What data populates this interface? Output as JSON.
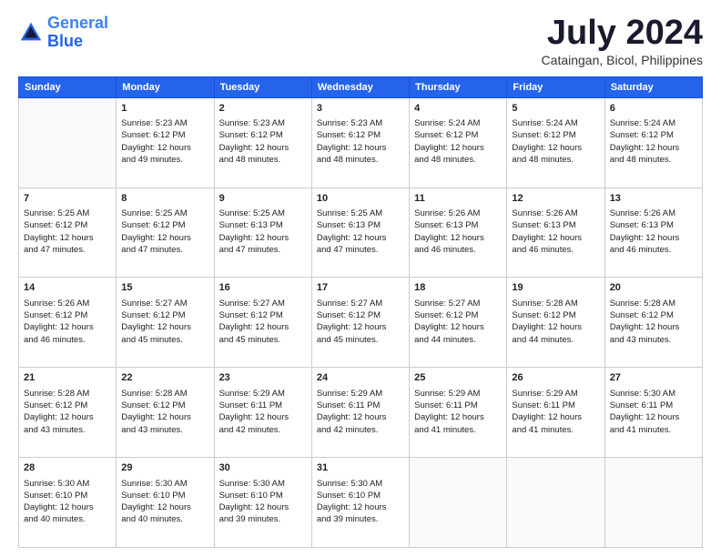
{
  "logo": {
    "line1": "General",
    "line2": "Blue"
  },
  "title": "July 2024",
  "subtitle": "Cataingan, Bicol, Philippines",
  "weekdays": [
    "Sunday",
    "Monday",
    "Tuesday",
    "Wednesday",
    "Thursday",
    "Friday",
    "Saturday"
  ],
  "weeks": [
    [
      {
        "day": "",
        "lines": []
      },
      {
        "day": "1",
        "lines": [
          "Sunrise: 5:23 AM",
          "Sunset: 6:12 PM",
          "Daylight: 12 hours",
          "and 49 minutes."
        ]
      },
      {
        "day": "2",
        "lines": [
          "Sunrise: 5:23 AM",
          "Sunset: 6:12 PM",
          "Daylight: 12 hours",
          "and 48 minutes."
        ]
      },
      {
        "day": "3",
        "lines": [
          "Sunrise: 5:23 AM",
          "Sunset: 6:12 PM",
          "Daylight: 12 hours",
          "and 48 minutes."
        ]
      },
      {
        "day": "4",
        "lines": [
          "Sunrise: 5:24 AM",
          "Sunset: 6:12 PM",
          "Daylight: 12 hours",
          "and 48 minutes."
        ]
      },
      {
        "day": "5",
        "lines": [
          "Sunrise: 5:24 AM",
          "Sunset: 6:12 PM",
          "Daylight: 12 hours",
          "and 48 minutes."
        ]
      },
      {
        "day": "6",
        "lines": [
          "Sunrise: 5:24 AM",
          "Sunset: 6:12 PM",
          "Daylight: 12 hours",
          "and 48 minutes."
        ]
      }
    ],
    [
      {
        "day": "7",
        "lines": [
          "Sunrise: 5:25 AM",
          "Sunset: 6:12 PM",
          "Daylight: 12 hours",
          "and 47 minutes."
        ]
      },
      {
        "day": "8",
        "lines": [
          "Sunrise: 5:25 AM",
          "Sunset: 6:12 PM",
          "Daylight: 12 hours",
          "and 47 minutes."
        ]
      },
      {
        "day": "9",
        "lines": [
          "Sunrise: 5:25 AM",
          "Sunset: 6:13 PM",
          "Daylight: 12 hours",
          "and 47 minutes."
        ]
      },
      {
        "day": "10",
        "lines": [
          "Sunrise: 5:25 AM",
          "Sunset: 6:13 PM",
          "Daylight: 12 hours",
          "and 47 minutes."
        ]
      },
      {
        "day": "11",
        "lines": [
          "Sunrise: 5:26 AM",
          "Sunset: 6:13 PM",
          "Daylight: 12 hours",
          "and 46 minutes."
        ]
      },
      {
        "day": "12",
        "lines": [
          "Sunrise: 5:26 AM",
          "Sunset: 6:13 PM",
          "Daylight: 12 hours",
          "and 46 minutes."
        ]
      },
      {
        "day": "13",
        "lines": [
          "Sunrise: 5:26 AM",
          "Sunset: 6:13 PM",
          "Daylight: 12 hours",
          "and 46 minutes."
        ]
      }
    ],
    [
      {
        "day": "14",
        "lines": [
          "Sunrise: 5:26 AM",
          "Sunset: 6:12 PM",
          "Daylight: 12 hours",
          "and 46 minutes."
        ]
      },
      {
        "day": "15",
        "lines": [
          "Sunrise: 5:27 AM",
          "Sunset: 6:12 PM",
          "Daylight: 12 hours",
          "and 45 minutes."
        ]
      },
      {
        "day": "16",
        "lines": [
          "Sunrise: 5:27 AM",
          "Sunset: 6:12 PM",
          "Daylight: 12 hours",
          "and 45 minutes."
        ]
      },
      {
        "day": "17",
        "lines": [
          "Sunrise: 5:27 AM",
          "Sunset: 6:12 PM",
          "Daylight: 12 hours",
          "and 45 minutes."
        ]
      },
      {
        "day": "18",
        "lines": [
          "Sunrise: 5:27 AM",
          "Sunset: 6:12 PM",
          "Daylight: 12 hours",
          "and 44 minutes."
        ]
      },
      {
        "day": "19",
        "lines": [
          "Sunrise: 5:28 AM",
          "Sunset: 6:12 PM",
          "Daylight: 12 hours",
          "and 44 minutes."
        ]
      },
      {
        "day": "20",
        "lines": [
          "Sunrise: 5:28 AM",
          "Sunset: 6:12 PM",
          "Daylight: 12 hours",
          "and 43 minutes."
        ]
      }
    ],
    [
      {
        "day": "21",
        "lines": [
          "Sunrise: 5:28 AM",
          "Sunset: 6:12 PM",
          "Daylight: 12 hours",
          "and 43 minutes."
        ]
      },
      {
        "day": "22",
        "lines": [
          "Sunrise: 5:28 AM",
          "Sunset: 6:12 PM",
          "Daylight: 12 hours",
          "and 43 minutes."
        ]
      },
      {
        "day": "23",
        "lines": [
          "Sunrise: 5:29 AM",
          "Sunset: 6:11 PM",
          "Daylight: 12 hours",
          "and 42 minutes."
        ]
      },
      {
        "day": "24",
        "lines": [
          "Sunrise: 5:29 AM",
          "Sunset: 6:11 PM",
          "Daylight: 12 hours",
          "and 42 minutes."
        ]
      },
      {
        "day": "25",
        "lines": [
          "Sunrise: 5:29 AM",
          "Sunset: 6:11 PM",
          "Daylight: 12 hours",
          "and 41 minutes."
        ]
      },
      {
        "day": "26",
        "lines": [
          "Sunrise: 5:29 AM",
          "Sunset: 6:11 PM",
          "Daylight: 12 hours",
          "and 41 minutes."
        ]
      },
      {
        "day": "27",
        "lines": [
          "Sunrise: 5:30 AM",
          "Sunset: 6:11 PM",
          "Daylight: 12 hours",
          "and 41 minutes."
        ]
      }
    ],
    [
      {
        "day": "28",
        "lines": [
          "Sunrise: 5:30 AM",
          "Sunset: 6:10 PM",
          "Daylight: 12 hours",
          "and 40 minutes."
        ]
      },
      {
        "day": "29",
        "lines": [
          "Sunrise: 5:30 AM",
          "Sunset: 6:10 PM",
          "Daylight: 12 hours",
          "and 40 minutes."
        ]
      },
      {
        "day": "30",
        "lines": [
          "Sunrise: 5:30 AM",
          "Sunset: 6:10 PM",
          "Daylight: 12 hours",
          "and 39 minutes."
        ]
      },
      {
        "day": "31",
        "lines": [
          "Sunrise: 5:30 AM",
          "Sunset: 6:10 PM",
          "Daylight: 12 hours",
          "and 39 minutes."
        ]
      },
      {
        "day": "",
        "lines": []
      },
      {
        "day": "",
        "lines": []
      },
      {
        "day": "",
        "lines": []
      }
    ]
  ]
}
